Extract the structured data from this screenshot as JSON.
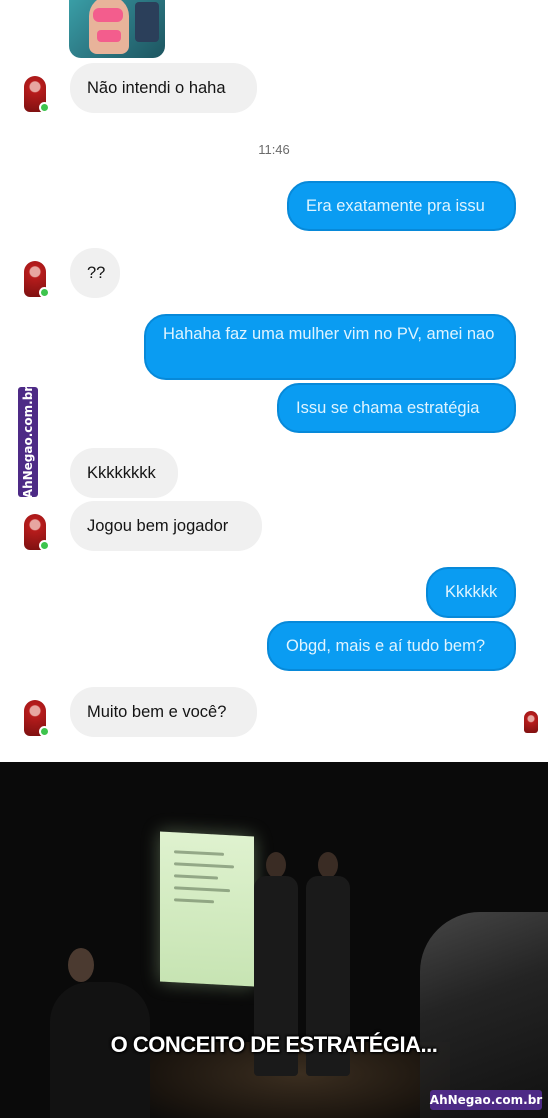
{
  "conversation": {
    "timestamp": "11:46",
    "messages": [
      {
        "id": "m1",
        "side": "incoming",
        "text": "Não intendi o haha"
      },
      {
        "id": "m2",
        "side": "outgoing",
        "text": "Era exatamente pra issu"
      },
      {
        "id": "m3",
        "side": "incoming",
        "text": "??"
      },
      {
        "id": "m4",
        "side": "outgoing",
        "text": "Hahaha faz uma mulher vim no PV, amei nao"
      },
      {
        "id": "m5",
        "side": "outgoing",
        "text": "Issu se chama estratégia"
      },
      {
        "id": "m6",
        "side": "incoming",
        "text": "Kkkkkkkk"
      },
      {
        "id": "m7",
        "side": "incoming",
        "text": "Jogou bem jogador"
      },
      {
        "id": "m8",
        "side": "outgoing",
        "text": "Kkkkkk"
      },
      {
        "id": "m9",
        "side": "outgoing",
        "text": "Obgd, mais e aí tudo bem?"
      },
      {
        "id": "m10",
        "side": "incoming",
        "text": "Muito bem e você?"
      }
    ]
  },
  "meme": {
    "subtitle": "O CONCEITO DE ESTRATÉGIA..."
  },
  "watermark": {
    "side_text": "AhNegao.com.br",
    "bottom_text": "AhNegao.com.br",
    "color": "#4d2a86"
  },
  "colors": {
    "outgoing_bubble": "#0a9cf2",
    "incoming_bubble": "#f0f0f0",
    "online_dot": "#3ec44d"
  }
}
